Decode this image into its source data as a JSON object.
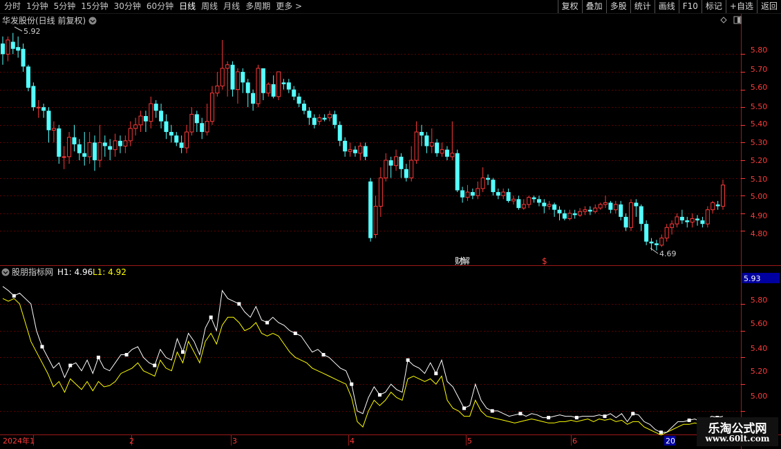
{
  "toolbar": {
    "tabs": [
      "分时",
      "1分钟",
      "5分钟",
      "15分钟",
      "30分钟",
      "60分钟",
      "日线",
      "周线",
      "月线",
      "多周期",
      "更多 >"
    ],
    "active_tab": "日线",
    "right_buttons": [
      "复权",
      "叠加",
      "多股",
      "统计",
      "画线",
      "F10",
      "标记",
      "+自选",
      "返回"
    ]
  },
  "main_panel": {
    "title": "华发股份(日线 前复权)",
    "high_label": "5.92",
    "low_label": "4.69",
    "event_labels": [
      "财",
      "解",
      "$"
    ],
    "price_axis": [
      "5.80",
      "5.70",
      "5.60",
      "5.50",
      "5.40",
      "5.30",
      "5.20",
      "5.10",
      "5.00",
      "4.90",
      "4.80"
    ]
  },
  "indicator_panel": {
    "name": "股朋指标网",
    "h1_label": "H1: 4.96",
    "l1_label": "L1: 4.92",
    "current_value": "5.93",
    "axis": [
      "5.80",
      "5.60",
      "5.40",
      "5.20",
      "5.00"
    ]
  },
  "date_axis": [
    "2024年1",
    "2",
    "3",
    "4",
    "5",
    "6",
    "20"
  ],
  "watermark": {
    "line1": "乐淘公式网",
    "line2": "www.60lt.com"
  },
  "colors": {
    "up": "#ff3a3a",
    "down": "#54ffff",
    "grid": "#8b0000",
    "axis": "#ff3a3a",
    "h1": "#ffffff",
    "l1": "#ffff00",
    "bg": "#000000"
  },
  "chart_data": {
    "type": "candlestick",
    "title": "华发股份(日线 前复权)",
    "ylim": [
      4.7,
      5.95
    ],
    "candles": [
      {
        "o": 5.86,
        "c": 5.8,
        "h": 5.9,
        "l": 5.74
      },
      {
        "o": 5.8,
        "c": 5.88,
        "h": 5.9,
        "l": 5.76
      },
      {
        "o": 5.87,
        "c": 5.83,
        "h": 5.92,
        "l": 5.8
      },
      {
        "o": 5.84,
        "c": 5.82,
        "h": 5.9,
        "l": 5.78
      },
      {
        "o": 5.83,
        "c": 5.73,
        "h": 5.86,
        "l": 5.7
      },
      {
        "o": 5.73,
        "c": 5.61,
        "h": 5.74,
        "l": 5.59
      },
      {
        "o": 5.62,
        "c": 5.5,
        "h": 5.64,
        "l": 5.48
      },
      {
        "o": 5.5,
        "c": 5.5,
        "h": 5.54,
        "l": 5.44
      },
      {
        "o": 5.5,
        "c": 5.48,
        "h": 5.52,
        "l": 5.44
      },
      {
        "o": 5.48,
        "c": 5.37,
        "h": 5.5,
        "l": 5.3
      },
      {
        "o": 5.37,
        "c": 5.38,
        "h": 5.42,
        "l": 5.3
      },
      {
        "o": 5.38,
        "c": 5.22,
        "h": 5.4,
        "l": 5.18
      },
      {
        "o": 5.22,
        "c": 5.22,
        "h": 5.28,
        "l": 5.15
      },
      {
        "o": 5.22,
        "c": 5.33,
        "h": 5.36,
        "l": 5.18
      },
      {
        "o": 5.33,
        "c": 5.29,
        "h": 5.4,
        "l": 5.25
      },
      {
        "o": 5.29,
        "c": 5.24,
        "h": 5.32,
        "l": 5.2
      },
      {
        "o": 5.24,
        "c": 5.22,
        "h": 5.36,
        "l": 5.17
      },
      {
        "o": 5.22,
        "c": 5.3,
        "h": 5.36,
        "l": 5.18
      },
      {
        "o": 5.3,
        "c": 5.2,
        "h": 5.34,
        "l": 5.14
      },
      {
        "o": 5.2,
        "c": 5.3,
        "h": 5.4,
        "l": 5.16
      },
      {
        "o": 5.3,
        "c": 5.28,
        "h": 5.34,
        "l": 5.22
      },
      {
        "o": 5.28,
        "c": 5.26,
        "h": 5.32,
        "l": 5.2
      },
      {
        "o": 5.26,
        "c": 5.31,
        "h": 5.35,
        "l": 5.22
      },
      {
        "o": 5.31,
        "c": 5.28,
        "h": 5.34,
        "l": 5.24
      },
      {
        "o": 5.28,
        "c": 5.31,
        "h": 5.34,
        "l": 5.24
      },
      {
        "o": 5.31,
        "c": 5.38,
        "h": 5.42,
        "l": 5.28
      },
      {
        "o": 5.38,
        "c": 5.4,
        "h": 5.44,
        "l": 5.34
      },
      {
        "o": 5.4,
        "c": 5.45,
        "h": 5.48,
        "l": 5.36
      },
      {
        "o": 5.45,
        "c": 5.42,
        "h": 5.48,
        "l": 5.36
      },
      {
        "o": 5.42,
        "c": 5.52,
        "h": 5.56,
        "l": 5.38
      },
      {
        "o": 5.52,
        "c": 5.48,
        "h": 5.54,
        "l": 5.44
      },
      {
        "o": 5.48,
        "c": 5.42,
        "h": 5.52,
        "l": 5.38
      },
      {
        "o": 5.42,
        "c": 5.36,
        "h": 5.46,
        "l": 5.32
      },
      {
        "o": 5.36,
        "c": 5.34,
        "h": 5.4,
        "l": 5.3
      },
      {
        "o": 5.34,
        "c": 5.3,
        "h": 5.36,
        "l": 5.28
      },
      {
        "o": 5.3,
        "c": 5.27,
        "h": 5.34,
        "l": 5.24
      },
      {
        "o": 5.27,
        "c": 5.36,
        "h": 5.4,
        "l": 5.24
      },
      {
        "o": 5.36,
        "c": 5.46,
        "h": 5.5,
        "l": 5.34
      },
      {
        "o": 5.46,
        "c": 5.41,
        "h": 5.48,
        "l": 5.36
      },
      {
        "o": 5.41,
        "c": 5.36,
        "h": 5.44,
        "l": 5.32
      },
      {
        "o": 5.36,
        "c": 5.42,
        "h": 5.52,
        "l": 5.34
      },
      {
        "o": 5.42,
        "c": 5.58,
        "h": 5.62,
        "l": 5.4
      },
      {
        "o": 5.58,
        "c": 5.62,
        "h": 5.7,
        "l": 5.56
      },
      {
        "o": 5.62,
        "c": 5.72,
        "h": 5.88,
        "l": 5.6
      },
      {
        "o": 5.72,
        "c": 5.74,
        "h": 5.76,
        "l": 5.56
      },
      {
        "o": 5.74,
        "c": 5.6,
        "h": 5.76,
        "l": 5.56
      },
      {
        "o": 5.6,
        "c": 5.7,
        "h": 5.72,
        "l": 5.52
      },
      {
        "o": 5.7,
        "c": 5.64,
        "h": 5.72,
        "l": 5.58
      },
      {
        "o": 5.64,
        "c": 5.58,
        "h": 5.66,
        "l": 5.5
      },
      {
        "o": 5.58,
        "c": 5.52,
        "h": 5.6,
        "l": 5.48
      },
      {
        "o": 5.52,
        "c": 5.72,
        "h": 5.74,
        "l": 5.5
      },
      {
        "o": 5.72,
        "c": 5.58,
        "h": 5.72,
        "l": 5.54
      },
      {
        "o": 5.58,
        "c": 5.63,
        "h": 5.64,
        "l": 5.56
      },
      {
        "o": 5.63,
        "c": 5.56,
        "h": 5.68,
        "l": 5.55
      },
      {
        "o": 5.56,
        "c": 5.7,
        "h": 5.7,
        "l": 5.54
      },
      {
        "o": 5.64,
        "c": 5.63,
        "h": 5.66,
        "l": 5.6
      },
      {
        "o": 5.64,
        "c": 5.6,
        "h": 5.66,
        "l": 5.58
      },
      {
        "o": 5.6,
        "c": 5.56,
        "h": 5.62,
        "l": 5.54
      },
      {
        "o": 5.56,
        "c": 5.52,
        "h": 5.58,
        "l": 5.5
      },
      {
        "o": 5.52,
        "c": 5.48,
        "h": 5.54,
        "l": 5.46
      },
      {
        "o": 5.48,
        "c": 5.44,
        "h": 5.5,
        "l": 5.4
      },
      {
        "o": 5.44,
        "c": 5.4,
        "h": 5.46,
        "l": 5.38
      },
      {
        "o": 5.42,
        "c": 5.44,
        "h": 5.46,
        "l": 5.4
      },
      {
        "o": 5.44,
        "c": 5.43,
        "h": 5.46,
        "l": 5.42
      },
      {
        "o": 5.44,
        "c": 5.46,
        "h": 5.48,
        "l": 5.42
      },
      {
        "o": 5.46,
        "c": 5.4,
        "h": 5.48,
        "l": 5.38
      },
      {
        "o": 5.4,
        "c": 5.31,
        "h": 5.42,
        "l": 5.28
      },
      {
        "o": 5.31,
        "c": 5.25,
        "h": 5.33,
        "l": 5.22
      },
      {
        "o": 5.25,
        "c": 5.26,
        "h": 5.3,
        "l": 5.22
      },
      {
        "o": 5.26,
        "c": 5.24,
        "h": 5.28,
        "l": 5.22
      },
      {
        "o": 5.24,
        "c": 5.28,
        "h": 5.3,
        "l": 5.2
      },
      {
        "o": 5.28,
        "c": 5.22,
        "h": 5.3,
        "l": 5.2
      },
      {
        "o": 5.08,
        "c": 4.76,
        "h": 5.1,
        "l": 4.74
      },
      {
        "o": 4.78,
        "c": 4.94,
        "h": 5.0,
        "l": 4.76
      },
      {
        "o": 4.94,
        "c": 5.1,
        "h": 5.16,
        "l": 4.88
      },
      {
        "o": 5.1,
        "c": 5.2,
        "h": 5.24,
        "l": 5.08
      },
      {
        "o": 5.2,
        "c": 5.17,
        "h": 5.22,
        "l": 5.1
      },
      {
        "o": 5.17,
        "c": 5.22,
        "h": 5.26,
        "l": 5.14
      },
      {
        "o": 5.22,
        "c": 5.15,
        "h": 5.24,
        "l": 5.1
      },
      {
        "o": 5.15,
        "c": 5.1,
        "h": 5.18,
        "l": 5.08
      },
      {
        "o": 5.1,
        "c": 5.2,
        "h": 5.28,
        "l": 5.08
      },
      {
        "o": 5.2,
        "c": 5.36,
        "h": 5.42,
        "l": 5.18
      },
      {
        "o": 5.36,
        "c": 5.34,
        "h": 5.4,
        "l": 5.28
      },
      {
        "o": 5.34,
        "c": 5.28,
        "h": 5.36,
        "l": 5.24
      },
      {
        "o": 5.28,
        "c": 5.3,
        "h": 5.38,
        "l": 5.24
      },
      {
        "o": 5.3,
        "c": 5.24,
        "h": 5.32,
        "l": 5.22
      },
      {
        "o": 5.24,
        "c": 5.26,
        "h": 5.3,
        "l": 5.22
      },
      {
        "o": 5.26,
        "c": 5.22,
        "h": 5.28,
        "l": 5.2
      },
      {
        "o": 5.22,
        "c": 5.24,
        "h": 5.42,
        "l": 5.2
      },
      {
        "o": 5.24,
        "c": 5.03,
        "h": 5.26,
        "l": 5.02
      },
      {
        "o": 5.03,
        "c": 4.99,
        "h": 5.05,
        "l": 4.96
      },
      {
        "o": 4.99,
        "c": 5.02,
        "h": 5.06,
        "l": 4.97
      },
      {
        "o": 5.02,
        "c": 5.0,
        "h": 5.04,
        "l": 4.98
      },
      {
        "o": 5.0,
        "c": 5.04,
        "h": 5.08,
        "l": 4.98
      },
      {
        "o": 5.04,
        "c": 5.1,
        "h": 5.16,
        "l": 5.02
      },
      {
        "o": 5.1,
        "c": 5.09,
        "h": 5.12,
        "l": 5.06
      },
      {
        "o": 5.09,
        "c": 5.02,
        "h": 5.1,
        "l": 5.0
      },
      {
        "o": 5.02,
        "c": 5.0,
        "h": 5.04,
        "l": 4.98
      },
      {
        "o": 5.0,
        "c": 5.02,
        "h": 5.04,
        "l": 4.98
      },
      {
        "o": 5.02,
        "c": 4.97,
        "h": 5.04,
        "l": 4.96
      },
      {
        "o": 4.97,
        "c": 4.98,
        "h": 5.0,
        "l": 4.95
      },
      {
        "o": 4.98,
        "c": 4.93,
        "h": 5.0,
        "l": 4.92
      },
      {
        "o": 4.93,
        "c": 4.95,
        "h": 4.98,
        "l": 4.92
      },
      {
        "o": 4.95,
        "c": 4.99,
        "h": 5.0,
        "l": 4.93
      },
      {
        "o": 4.99,
        "c": 4.98,
        "h": 5.0,
        "l": 4.96
      },
      {
        "o": 4.98,
        "c": 4.96,
        "h": 5.0,
        "l": 4.94
      },
      {
        "o": 4.96,
        "c": 4.94,
        "h": 4.98,
        "l": 4.9
      },
      {
        "o": 4.94,
        "c": 4.95,
        "h": 4.97,
        "l": 4.92
      },
      {
        "o": 4.95,
        "c": 4.92,
        "h": 4.96,
        "l": 4.88
      },
      {
        "o": 4.92,
        "c": 4.9,
        "h": 4.94,
        "l": 4.86
      },
      {
        "o": 4.9,
        "c": 4.87,
        "h": 4.92,
        "l": 4.86
      },
      {
        "o": 4.87,
        "c": 4.9,
        "h": 4.92,
        "l": 4.86
      },
      {
        "o": 4.9,
        "c": 4.89,
        "h": 4.92,
        "l": 4.87
      },
      {
        "o": 4.89,
        "c": 4.91,
        "h": 4.93,
        "l": 4.88
      },
      {
        "o": 4.91,
        "c": 4.92,
        "h": 4.94,
        "l": 4.89
      },
      {
        "o": 4.92,
        "c": 4.91,
        "h": 4.94,
        "l": 4.89
      },
      {
        "o": 4.91,
        "c": 4.93,
        "h": 4.95,
        "l": 4.9
      },
      {
        "o": 4.93,
        "c": 4.95,
        "h": 4.96,
        "l": 4.92
      },
      {
        "o": 4.95,
        "c": 4.96,
        "h": 5.0,
        "l": 4.93
      },
      {
        "o": 4.96,
        "c": 4.92,
        "h": 4.97,
        "l": 4.9
      },
      {
        "o": 4.92,
        "c": 4.95,
        "h": 4.97,
        "l": 4.9
      },
      {
        "o": 4.95,
        "c": 4.88,
        "h": 4.97,
        "l": 4.86
      },
      {
        "o": 4.88,
        "c": 4.82,
        "h": 4.9,
        "l": 4.8
      },
      {
        "o": 4.82,
        "c": 4.96,
        "h": 4.98,
        "l": 4.8
      },
      {
        "o": 4.96,
        "c": 4.94,
        "h": 4.98,
        "l": 4.88
      },
      {
        "o": 4.94,
        "c": 4.84,
        "h": 4.95,
        "l": 4.8
      },
      {
        "o": 4.84,
        "c": 4.74,
        "h": 4.86,
        "l": 4.72
      },
      {
        "o": 4.74,
        "c": 4.73,
        "h": 4.76,
        "l": 4.69
      },
      {
        "o": 4.73,
        "c": 4.72,
        "h": 4.75,
        "l": 4.69
      },
      {
        "o": 4.72,
        "c": 4.76,
        "h": 4.78,
        "l": 4.71
      },
      {
        "o": 4.76,
        "c": 4.82,
        "h": 4.84,
        "l": 4.74
      },
      {
        "o": 4.82,
        "c": 4.84,
        "h": 4.86,
        "l": 4.78
      },
      {
        "o": 4.84,
        "c": 4.88,
        "h": 4.9,
        "l": 4.82
      },
      {
        "o": 4.88,
        "c": 4.86,
        "h": 4.92,
        "l": 4.84
      },
      {
        "o": 4.86,
        "c": 4.85,
        "h": 4.88,
        "l": 4.82
      },
      {
        "o": 4.85,
        "c": 4.87,
        "h": 4.9,
        "l": 4.82
      },
      {
        "o": 4.87,
        "c": 4.86,
        "h": 4.89,
        "l": 4.83
      },
      {
        "o": 4.86,
        "c": 4.84,
        "h": 4.88,
        "l": 4.82
      },
      {
        "o": 4.84,
        "c": 4.92,
        "h": 4.94,
        "l": 4.82
      },
      {
        "o": 4.92,
        "c": 4.96,
        "h": 4.97,
        "l": 4.9
      },
      {
        "o": 4.95,
        "c": 4.94,
        "h": 4.97,
        "l": 4.92
      },
      {
        "o": 4.94,
        "c": 5.06,
        "h": 5.09,
        "l": 4.92
      }
    ],
    "indicator": {
      "ylim": [
        4.86,
        5.97
      ],
      "H1": [
        5.93,
        5.9,
        5.86,
        5.88,
        5.84,
        5.8,
        5.6,
        5.48,
        5.4,
        5.32,
        5.36,
        5.25,
        5.34,
        5.36,
        5.3,
        5.38,
        5.28,
        5.4,
        5.32,
        5.3,
        5.36,
        5.42,
        5.42,
        5.46,
        5.48,
        5.4,
        5.36,
        5.34,
        5.46,
        5.4,
        5.38,
        5.54,
        5.44,
        5.58,
        5.52,
        5.42,
        5.62,
        5.7,
        5.6,
        5.9,
        5.84,
        5.82,
        5.8,
        5.74,
        5.7,
        5.78,
        5.68,
        5.66,
        5.7,
        5.66,
        5.64,
        5.6,
        5.58,
        5.56,
        5.5,
        5.44,
        5.46,
        5.42,
        5.4,
        5.36,
        5.32,
        5.3,
        5.2,
        5.0,
        4.98,
        5.1,
        5.18,
        5.12,
        5.14,
        5.2,
        5.16,
        5.14,
        5.38,
        5.34,
        5.32,
        5.28,
        5.36,
        5.28,
        5.38,
        5.22,
        5.18,
        5.1,
        5.02,
        5.04,
        5.2,
        5.08,
        5.02,
        5.0,
        5.0,
        4.98,
        4.96,
        4.97,
        4.98,
        4.96,
        4.98,
        4.97,
        4.95,
        4.95,
        4.96,
        4.97,
        4.96,
        4.96,
        4.95,
        4.96,
        4.96,
        4.96,
        4.97,
        4.96,
        4.98,
        4.95,
        4.98,
        4.92,
        4.98,
        4.97,
        4.92,
        4.9,
        4.86,
        4.84,
        4.84,
        4.88,
        4.92,
        4.92,
        4.93,
        4.94,
        4.92,
        4.93,
        4.96,
        4.95,
        4.96
      ],
      "L1": [
        5.84,
        5.82,
        5.84,
        5.8,
        5.66,
        5.52,
        5.44,
        5.36,
        5.28,
        5.18,
        5.22,
        5.14,
        5.24,
        5.2,
        5.16,
        5.22,
        5.15,
        5.22,
        5.18,
        5.19,
        5.22,
        5.28,
        5.3,
        5.32,
        5.36,
        5.3,
        5.28,
        5.26,
        5.38,
        5.32,
        5.3,
        5.44,
        5.36,
        5.52,
        5.44,
        5.36,
        5.52,
        5.58,
        5.5,
        5.64,
        5.7,
        5.7,
        5.66,
        5.6,
        5.62,
        5.66,
        5.58,
        5.56,
        5.58,
        5.56,
        5.5,
        5.44,
        5.4,
        5.38,
        5.36,
        5.32,
        5.3,
        5.28,
        5.26,
        5.24,
        5.22,
        5.2,
        5.1,
        4.92,
        4.88,
        5.0,
        5.08,
        5.04,
        5.08,
        5.14,
        5.1,
        5.08,
        5.24,
        5.26,
        5.24,
        5.22,
        5.24,
        5.2,
        5.26,
        5.08,
        5.02,
        5.0,
        4.96,
        4.96,
        5.08,
        5.0,
        4.96,
        4.95,
        4.94,
        4.93,
        4.92,
        4.91,
        4.92,
        4.93,
        4.94,
        4.93,
        4.92,
        4.91,
        4.91,
        4.92,
        4.92,
        4.93,
        4.92,
        4.93,
        4.94,
        4.92,
        4.94,
        4.93,
        4.94,
        4.92,
        4.93,
        4.9,
        4.92,
        4.92,
        4.88,
        4.86,
        4.84,
        4.82,
        4.84,
        4.86,
        4.88,
        4.9,
        4.9,
        4.91,
        4.9,
        4.91,
        4.92,
        4.92,
        4.92
      ]
    }
  }
}
